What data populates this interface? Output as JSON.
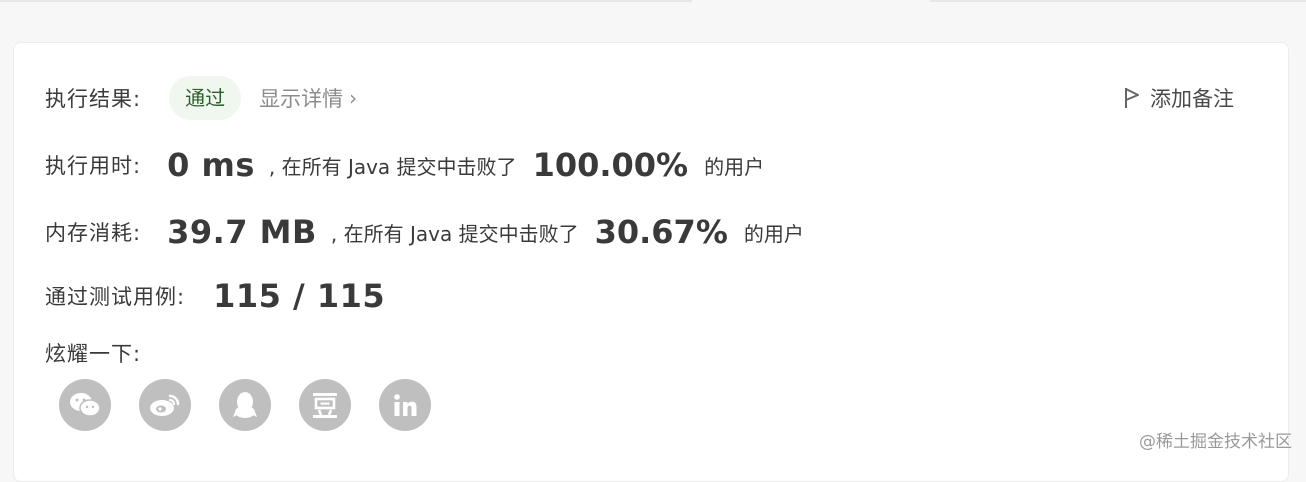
{
  "result": {
    "label": "执行结果:",
    "status": "通过",
    "details_link": "显示详情",
    "add_note": "添加备注"
  },
  "runtime": {
    "label": "执行用时:",
    "value": "0 ms",
    "mid_text": ", 在所有 Java 提交中击败了",
    "percent": "100.00%",
    "suffix": "的用户"
  },
  "memory": {
    "label": "内存消耗:",
    "value": "39.7 MB",
    "mid_text": ", 在所有 Java 提交中击败了",
    "percent": "30.67%",
    "suffix": "的用户"
  },
  "tests": {
    "label": "通过测试用例:",
    "value": "115 / 115"
  },
  "share": {
    "label": "炫耀一下:",
    "icons": [
      "wechat-icon",
      "weibo-icon",
      "qq-icon",
      "douban-icon",
      "linkedin-icon"
    ]
  },
  "watermark": "@稀土掘金技术社区",
  "colors": {
    "badge_bg": "#f0f7ef",
    "badge_text": "#2c5f2d",
    "share_icon_bg": "#bfbfbf"
  }
}
